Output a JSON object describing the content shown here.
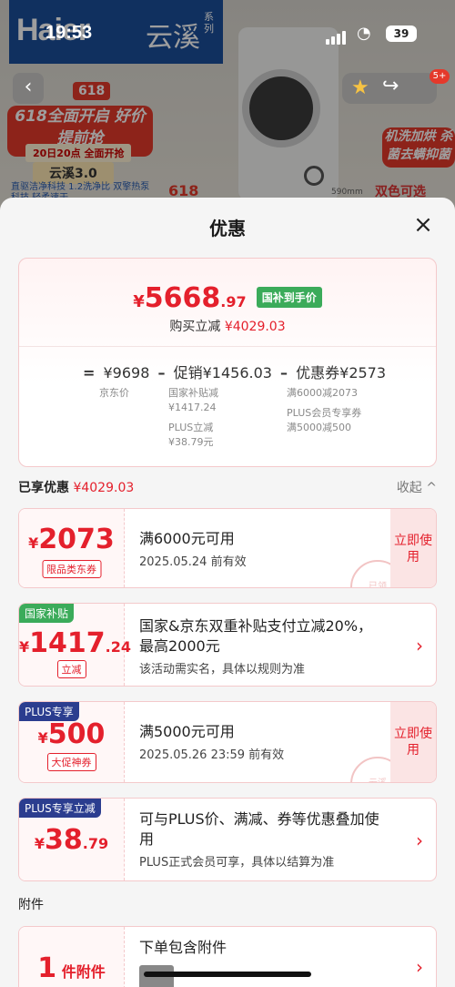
{
  "status": {
    "time": "19:53",
    "battery": "39"
  },
  "bg": {
    "brand": "Haier",
    "brand_series": "云溪",
    "brand_series_tag": "系列",
    "promo_618": "618",
    "promo_title": "618全面开启 好价提前抢",
    "promo_date": "20日20点 全面开抢",
    "promo_model": "云溪3.0",
    "promo_sub": "直驱洁净科技 1.2洗净比 双擎热泵科技 轻柔速干",
    "right_chip": "机洗加烘 杀菌去螨抑菌",
    "color_tag": "双色可选",
    "size_tag": "590mm",
    "badge": "5+"
  },
  "sheet": {
    "title": "优惠",
    "summary": {
      "yen": "¥",
      "price_int": "5668",
      "price_dec": ".97",
      "price_tag": "国补到手价",
      "reduce_label": "购买立减",
      "reduce_value": "¥4029.03",
      "formula": {
        "eq": "=",
        "jd_price": "¥9698",
        "minus1": "–",
        "promo": "促销¥1456.03",
        "minus2": "–",
        "coupon": "优惠券¥2573"
      },
      "jd_price_label": "京东价",
      "promo_sub1": "国家补贴减",
      "promo_sub1_val": "¥1417.24",
      "promo_sub2": "PLUS立减",
      "promo_sub2_val": "¥38.79元",
      "coupon_sub1": "满6000减2073",
      "coupon_sub2": "PLUS会员专享券",
      "coupon_sub2_val": "满5000减500"
    },
    "enjoyed": {
      "label": "已享优惠",
      "value": "¥4029.03",
      "collapse": "收起 ^"
    },
    "cards": [
      {
        "yen": "¥",
        "int": "2073",
        "dec": "",
        "minitag": "限品类东券",
        "l1": "满6000元可用",
        "l2": "2025.05.24 前有效",
        "action": "立即使用",
        "stamp": "已领"
      },
      {
        "corner": "国家补贴",
        "yen": "¥",
        "int": "1417",
        "dec": ".24",
        "minitag": "立减",
        "l1": "国家&京东双重补贴支付立减20%，最高2000元",
        "l2": "该活动需实名，具体以规则为准",
        "chev": "›"
      },
      {
        "corner": "PLUS专享",
        "yen": "¥",
        "int": "500",
        "dec": "",
        "minitag": "大促神券",
        "l1": "满5000元可用",
        "l2": "2025.05.26 23:59 前有效",
        "action": "立即使用",
        "stamp": "云溪"
      },
      {
        "corner": "PLUS专享立减",
        "yen": "¥",
        "int": "38",
        "dec": ".79",
        "l1": "可与PLUS价、满减、券等优惠叠加使用",
        "l2": "PLUS正式会员可享，具体以结算为准",
        "chev": "›"
      }
    ],
    "attachments": {
      "title": "附件",
      "count": "1",
      "count_unit": "件附件",
      "l1": "下单包含附件",
      "chev": "›"
    }
  },
  "colors": {
    "accent": "#e4202c",
    "green_tag": "#3bab5a",
    "plus_blue": "#2b3d8f",
    "subsidy_green": "#3bab5a"
  }
}
